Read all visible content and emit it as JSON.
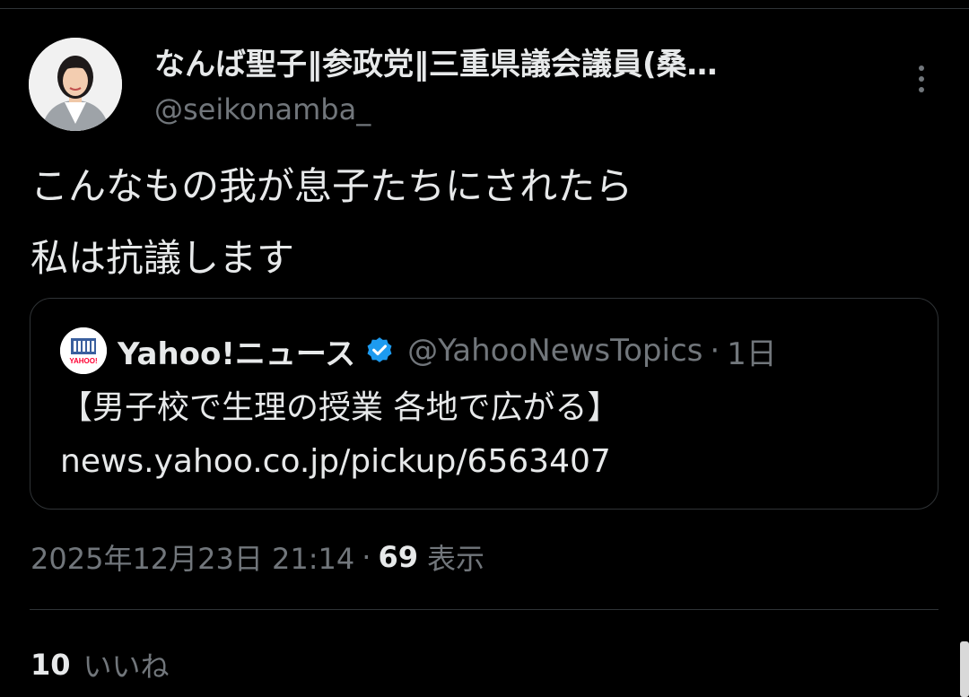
{
  "author": {
    "display_name": "なんば聖子‖参政党‖三重県議会議員(桑…",
    "handle": "@seikonamba_"
  },
  "tweet": {
    "lines": [
      "こんなもの我が息子たちにされたら",
      "私は抗議します"
    ]
  },
  "quoted_tweet": {
    "name": "Yahoo!ニュース",
    "handle": "@YahooNewsTopics",
    "separator": "·",
    "time": "1日",
    "text": "【男子校で生理の授業 各地で広がる】",
    "link": "news.yahoo.co.jp/pickup/6563407",
    "avatar_label": "YAHOO!"
  },
  "meta": {
    "timestamp": "2025年12月23日 21:14",
    "separator": "·",
    "views_count": "69",
    "views_label": "表示"
  },
  "stats": {
    "likes_count": "10",
    "likes_label": "いいね"
  },
  "colors": {
    "background": "#000000",
    "primary_text": "#e7e9ea",
    "secondary_text": "#71767b",
    "border": "#2f3336",
    "verified_badge": "#1d9bf0"
  }
}
